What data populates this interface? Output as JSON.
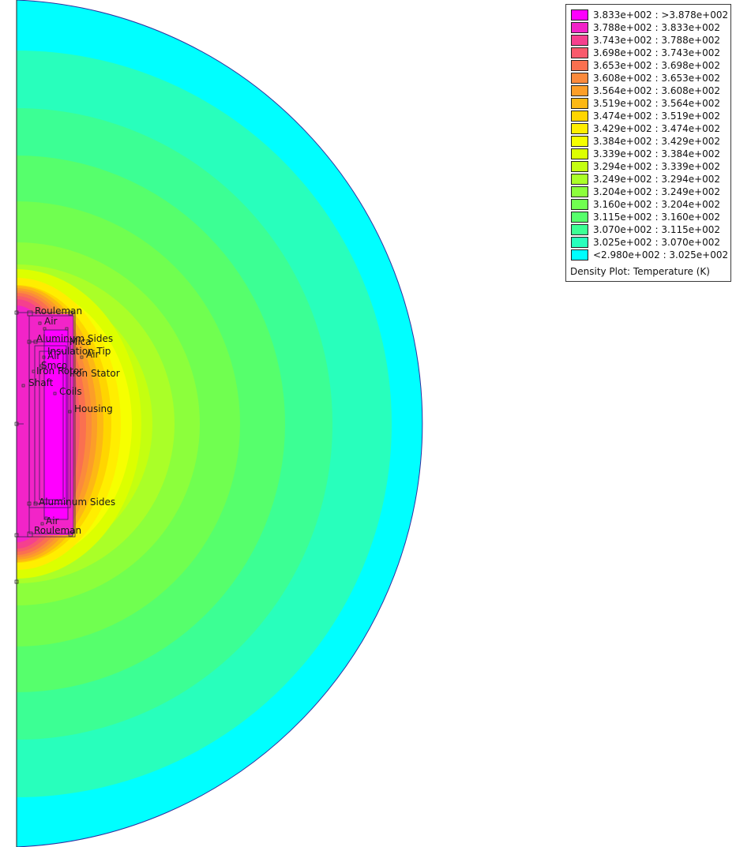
{
  "legend": {
    "caption": "Density Plot: Temperature (K)",
    "entries": [
      {
        "range": "3.833e+002 : >3.878e+002",
        "color": "#ff00ff"
      },
      {
        "range": "3.788e+002 : 3.833e+002",
        "color": "#f224c8"
      },
      {
        "range": "3.743e+002 : 3.788e+002",
        "color": "#f5408e"
      },
      {
        "range": "3.698e+002 : 3.743e+002",
        "color": "#f85a6c"
      },
      {
        "range": "3.653e+002 : 3.698e+002",
        "color": "#fa7050"
      },
      {
        "range": "3.608e+002 : 3.653e+002",
        "color": "#fb8a3c"
      },
      {
        "range": "3.564e+002 : 3.608e+002",
        "color": "#fc9e28"
      },
      {
        "range": "3.519e+002 : 3.564e+002",
        "color": "#fdb814"
      },
      {
        "range": "3.474e+002 : 3.519e+002",
        "color": "#ffd500"
      },
      {
        "range": "3.429e+002 : 3.474e+002",
        "color": "#ffee00"
      },
      {
        "range": "3.384e+002 : 3.429e+002",
        "color": "#f6ff00"
      },
      {
        "range": "3.339e+002 : 3.384e+002",
        "color": "#dcff00"
      },
      {
        "range": "3.294e+002 : 3.339e+002",
        "color": "#c4ff10"
      },
      {
        "range": "3.249e+002 : 3.294e+002",
        "color": "#aaff28"
      },
      {
        "range": "3.204e+002 : 3.249e+002",
        "color": "#8cff3c"
      },
      {
        "range": "3.160e+002 : 3.204e+002",
        "color": "#70ff50"
      },
      {
        "range": "3.115e+002 : 3.160e+002",
        "color": "#56ff6c"
      },
      {
        "range": "3.070e+002 : 3.115e+002",
        "color": "#3cff94"
      },
      {
        "range": "3.025e+002 : 3.070e+002",
        "color": "#28ffbc"
      },
      {
        "range": "<2.980e+002 : 3.025e+002",
        "color": "#00ffff"
      }
    ]
  },
  "labels": {
    "rouleman_top": "Rouleman",
    "air_top": "Air",
    "aluminum_sides_top": "Aluminum Sides",
    "mica": "Mica",
    "insulation_tip": "Insulation Tip",
    "air_mid_left": "Air",
    "air_mid_right": "Air",
    "smco": "Smco",
    "iron_rotor": "Iron Rotor",
    "iron_stator": "Iron Stator",
    "shaft": "Shaft",
    "coils": "Coils",
    "housing": "Housing",
    "aluminum_sides_bottom": "Aluminum Sides",
    "air_bottom": "Air",
    "rouleman_bottom": "Rouleman"
  },
  "colors": {
    "boundary": "#3030a0",
    "geometry": "#000000"
  }
}
